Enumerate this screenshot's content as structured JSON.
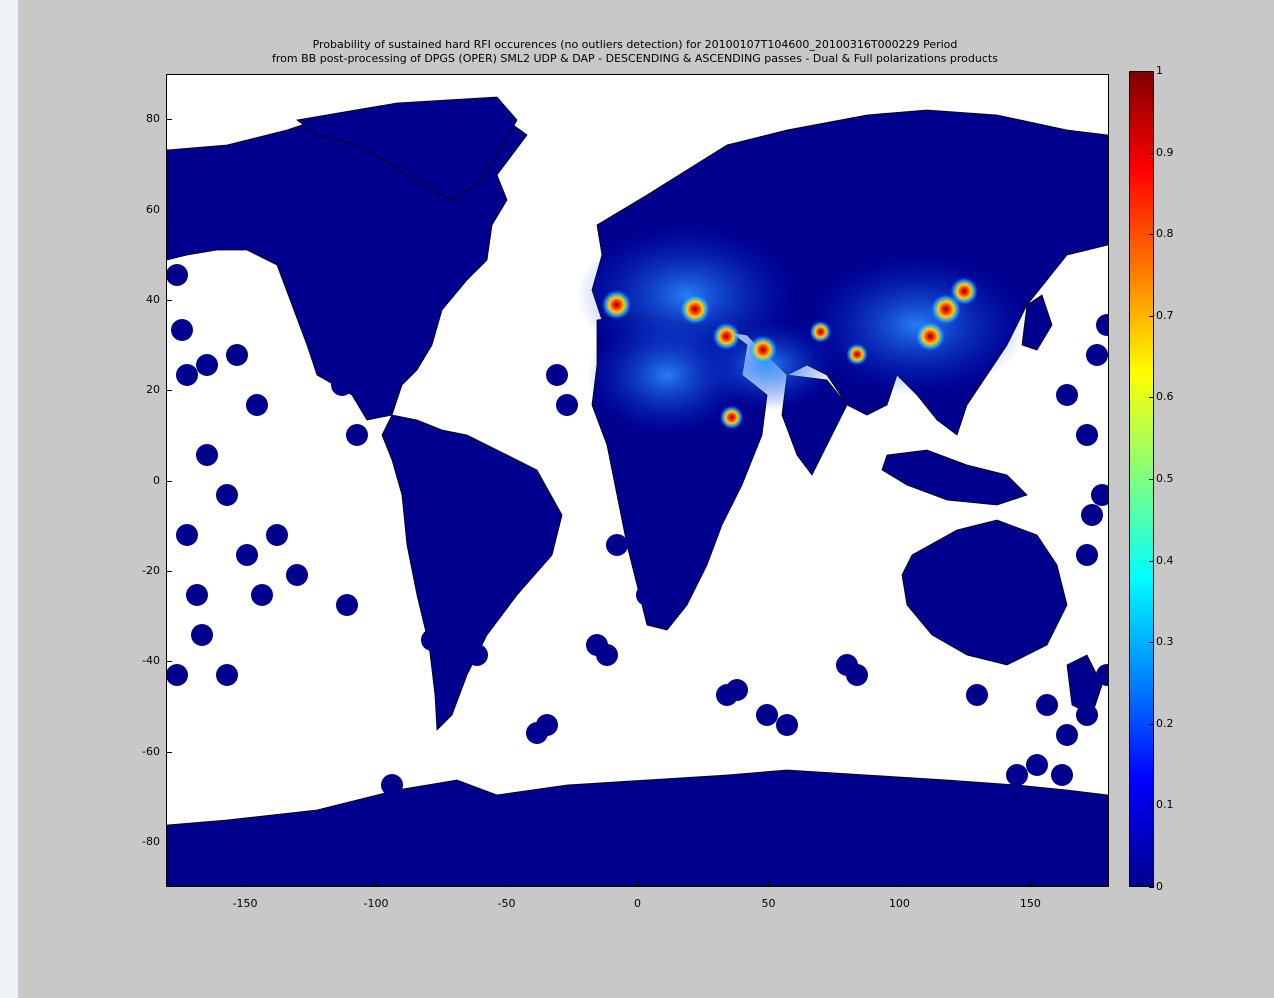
{
  "title": {
    "line1": "Probability of sustained hard RFI occurences (no outliers detection) for 20100107T104600_20100316T000229 Period",
    "line2": "from BB post-processing of DPGS (OPER) SML2 UDP & DAP - DESCENDING & ASCENDING passes - Dual & Full polarizations products"
  },
  "map": {
    "x_ticks": [
      -150,
      -100,
      -50,
      0,
      50,
      100,
      150
    ],
    "y_ticks": [
      80,
      60,
      40,
      20,
      0,
      -20,
      -40,
      -60,
      -80
    ],
    "xlim": [
      -180,
      180
    ],
    "ylim": [
      -90,
      90
    ],
    "land_color": "#00008f",
    "ocean_color": "#ffffff",
    "hotspots": [
      {
        "lon": -8,
        "lat": 39,
        "value": 0.9
      },
      {
        "lon": 22,
        "lat": 38,
        "value": 0.95
      },
      {
        "lon": 34,
        "lat": 32,
        "value": 0.8
      },
      {
        "lon": 48,
        "lat": 29,
        "value": 0.85
      },
      {
        "lon": 36,
        "lat": 14,
        "value": 0.6
      },
      {
        "lon": 118,
        "lat": 38,
        "value": 0.95
      },
      {
        "lon": 112,
        "lat": 32,
        "value": 0.9
      },
      {
        "lon": 125,
        "lat": 42,
        "value": 0.8
      },
      {
        "lon": 84,
        "lat": 28,
        "value": 0.5
      },
      {
        "lon": 70,
        "lat": 33,
        "value": 0.5
      }
    ]
  },
  "colorbar": {
    "ticks": [
      1,
      0.9,
      0.8,
      0.7,
      0.6,
      0.5,
      0.4,
      0.3,
      0.2,
      0.1,
      0
    ],
    "range": [
      0,
      1
    ],
    "colormap": "jet"
  }
}
